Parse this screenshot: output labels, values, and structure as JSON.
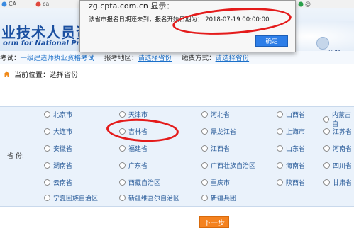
{
  "browser_bar": {
    "fav1": "CA",
    "fav2": "ca",
    "fav3": "@"
  },
  "header": {
    "title": "业技术人员资格",
    "subtitle": "orm for National Profe",
    "right_link": "注册"
  },
  "info_bar": {
    "exam_label": "考试：",
    "exam_value": "一级建造师执业资格考试",
    "region_label": "报考地区：",
    "region_value": "请选择省份",
    "fee_label": "缴费方式：",
    "fee_value": "请选择省份"
  },
  "breadcrumb": {
    "text": "当前位置：选择省份"
  },
  "province_section": {
    "label": "省    份:",
    "provinces": [
      "北京市",
      "天津市",
      "河北省",
      "山西省",
      "内蒙古自",
      "大连市",
      "吉林省",
      "黑龙江省",
      "上海市",
      "江苏省",
      "安徽省",
      "福建省",
      "江西省",
      "山东省",
      "河南省",
      "湖南省",
      "广东省",
      "广西壮族自治区",
      "海南省",
      "四川省",
      "云南省",
      "西藏自治区",
      "重庆市",
      "陕西省",
      "甘肃省",
      "宁夏回族自治区",
      "新疆维吾尔自治区",
      "新疆兵团"
    ]
  },
  "next_button": "下一步",
  "dialog": {
    "title": "zg.cpta.com.cn 显示：",
    "message": "该省市报名日期还未到，报名开始日期为：   2018-07-19 00:00:00",
    "ok_label": "确定"
  },
  "colors": {
    "brand": "#1a4fa0",
    "link": "#1a6fc9",
    "next_button": "#f4821f",
    "dialog_button": "#2d7ee8",
    "annotation": "#e41b1b"
  }
}
